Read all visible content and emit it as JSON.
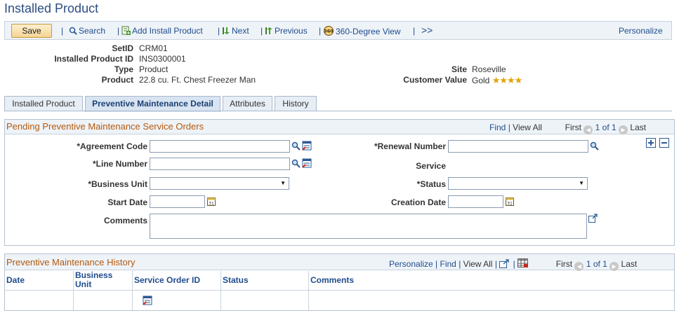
{
  "page": {
    "title": "Installed Product"
  },
  "toolbar": {
    "save_label": "Save",
    "search_label": "Search",
    "add_install_label": "Add Install Product",
    "next_label": "Next",
    "previous_label": "Previous",
    "view360_label": "360-Degree View",
    "more_label": ">>",
    "personalize_label": "Personalize"
  },
  "header": {
    "setid_label": "SetID",
    "setid_value": "CRM01",
    "installed_id_label": "Installed Product ID",
    "installed_id_value": "INS0300001",
    "type_label": "Type",
    "type_value": "Product",
    "product_label": "Product",
    "product_value": "22.8 cu. Ft. Chest Freezer Man",
    "site_label": "Site",
    "site_value": "Roseville",
    "customer_value_label": "Customer Value",
    "customer_value_value": "Gold",
    "stars": "★★★★"
  },
  "tabs": [
    {
      "label": "Installed Product"
    },
    {
      "label": "Preventive Maintenance Detail"
    },
    {
      "label": "Attributes"
    },
    {
      "label": "History"
    }
  ],
  "pending": {
    "title": "Pending Preventive Maintenance Service Orders",
    "find": "Find",
    "sep": "|",
    "view_all": "View All",
    "first": "First",
    "range": "1 of 1",
    "last": "Last",
    "agreement_code_label": "*Agreement Code",
    "line_number_label": "*Line Number",
    "business_unit_label": "*Business Unit",
    "start_date_label": "Start Date",
    "comments_label": "Comments",
    "renewal_number_label": "*Renewal Number",
    "service_label": "Service",
    "status_label": "*Status",
    "creation_date_label": "Creation Date",
    "agreement_code_value": "",
    "line_number_value": "",
    "renewal_number_value": "",
    "start_date_value": "",
    "creation_date_value": ""
  },
  "history": {
    "title": "Preventive Maintenance History",
    "personalize": "Personalize",
    "find": "Find",
    "sep": "|",
    "view_all": "View All",
    "first": "First",
    "range": "1 of 1",
    "last": "Last",
    "columns": [
      "Date",
      "Business Unit",
      "Service Order ID",
      "Status",
      "Comments"
    ]
  },
  "colors": {
    "title_blue": "#2b4d82",
    "section_orange": "#b5590b",
    "link_blue": "#1f4c8c"
  }
}
